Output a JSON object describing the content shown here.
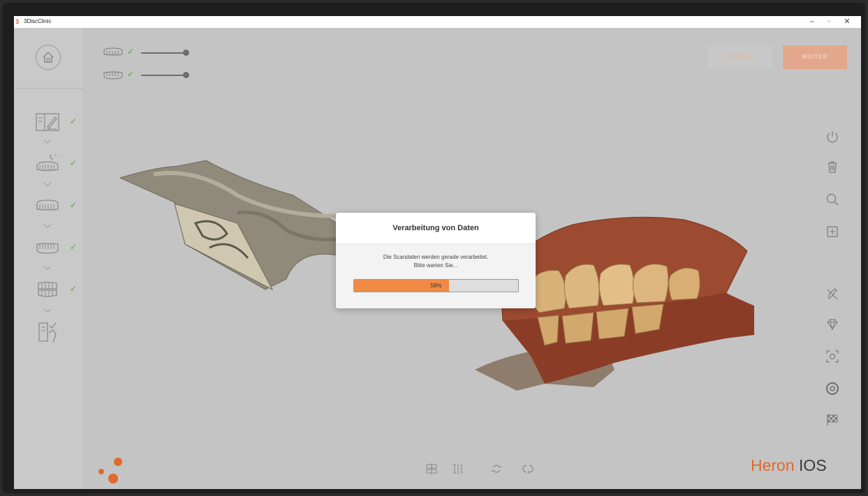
{
  "window": {
    "title": "3DiscClinic",
    "icon_glyph": "3",
    "minimize": "–",
    "maximize": "▫",
    "close": "✕"
  },
  "nav": {
    "back_label": "ZURÜCK",
    "next_label": "WEITER"
  },
  "sidebar": {
    "steps": [
      {
        "icon": "patient-form-icon",
        "done": true
      },
      {
        "icon": "scan-preparation-icon",
        "done": true
      },
      {
        "icon": "upper-jaw-icon",
        "done": true
      },
      {
        "icon": "lower-jaw-icon",
        "done": true
      },
      {
        "icon": "bite-icon",
        "done": true
      },
      {
        "icon": "review-icon",
        "done": false
      }
    ],
    "check_glyph": "✓"
  },
  "jaws": [
    {
      "icon": "upper-jaw-icon",
      "check": "✓",
      "slider_value": 1.0
    },
    {
      "icon": "lower-jaw-icon",
      "check": "✓",
      "slider_value": 1.0
    }
  ],
  "dialog": {
    "title": "Verarbeitung von Daten",
    "message_line1": "Die Scandaten werden gerade verarbeitet.",
    "message_line2": "Bitte warten Sie...",
    "progress_value": 58,
    "progress_label": "58%"
  },
  "brand": {
    "name": "Heron",
    "product": "IOS"
  },
  "colors": {
    "accent": "#e0692c",
    "check": "#59a83c",
    "progress": "#f08a44"
  }
}
